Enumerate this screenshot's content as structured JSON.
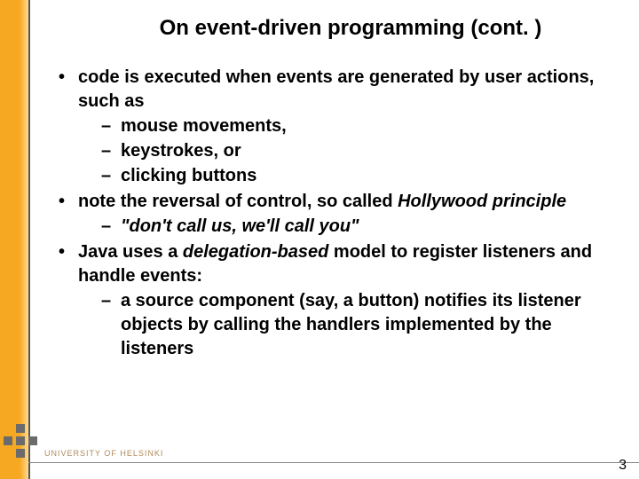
{
  "title": "On event-driven programming (cont. )",
  "bullets": [
    {
      "text": "code is executed when events are generated by user actions, such as",
      "sub": [
        "mouse movements,",
        "keystrokes, or",
        "clicking buttons"
      ]
    },
    {
      "text_html": "note the reversal of control, so called <span class=\"italic\">Hollywood principle</span>",
      "sub_html": [
        "<span class=\"italic\">\"don't call us, we'll call you\"</span>"
      ]
    },
    {
      "text_html": "Java uses a <span class=\"italic\">delegation-based</span> model to register listeners and handle events:",
      "sub": [
        "a source component (say, a button) notifies its listener objects by calling the handlers implemented by the listeners"
      ]
    }
  ],
  "footer": {
    "page_number": "3"
  },
  "branding": {
    "university": "UNIVERSITY OF HELSINKI"
  }
}
